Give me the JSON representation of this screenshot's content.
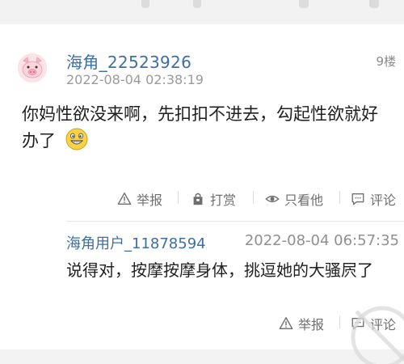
{
  "comment": {
    "username": "海角_22523926",
    "floor": "9楼",
    "timestamp": "2022-08-04 02:38:19",
    "body": "你妈性欲没来啊，先扣扣不进去，勾起性欲就好办了",
    "emoji": "grinning-face-emoji",
    "actions": {
      "report": "举报",
      "reward": "打赏",
      "only_author": "只看他",
      "comment": "评论"
    }
  },
  "reply": {
    "username": "海角用户_11878594",
    "timestamp": "2022-08-04 06:57:35",
    "body": "说得对，按摩按摩身体，挑逗她的大骚屄了",
    "actions": {
      "report": "举报",
      "comment": "评论"
    }
  },
  "colors": {
    "username": "#3c6fa6",
    "meta": "#9a9a9a",
    "action": "#6f6f6f",
    "avatar_bg": "#fce3e8"
  }
}
